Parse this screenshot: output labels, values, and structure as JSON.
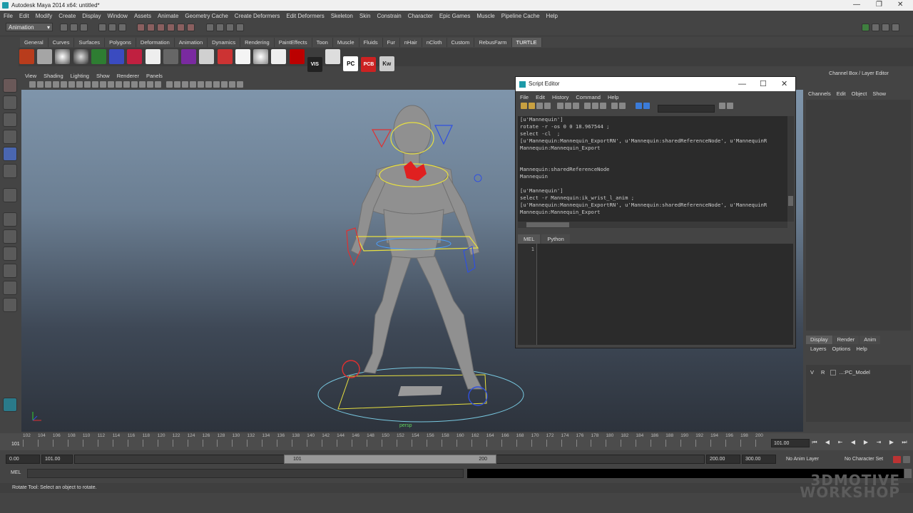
{
  "window": {
    "title": "Autodesk Maya 2014 x64: untitled*"
  },
  "menubar": [
    "File",
    "Edit",
    "Modify",
    "Create",
    "Display",
    "Window",
    "Assets",
    "Animate",
    "Geometry Cache",
    "Create Deformers",
    "Edit Deformers",
    "Skeleton",
    "Skin",
    "Constrain",
    "Character",
    "Epic Games",
    "Muscle",
    "Pipeline Cache",
    "Help"
  ],
  "status": {
    "mode": "Animation"
  },
  "shelf_tabs": [
    "General",
    "Curves",
    "Surfaces",
    "Polygons",
    "Deformation",
    "Animation",
    "Dynamics",
    "Rendering",
    "PaintEffects",
    "Toon",
    "Muscle",
    "Fluids",
    "Fur",
    "nHair",
    "nCloth",
    "Custom",
    "RebusFarm",
    "TURTLE"
  ],
  "shelf_active": "TURTLE",
  "shelf_labels": {
    "vis": "VIS",
    "pc": "PC",
    "pcb": "PCB",
    "kw": "Kw"
  },
  "viewport": {
    "menu": [
      "View",
      "Shading",
      "Lighting",
      "Show",
      "Renderer",
      "Panels"
    ],
    "camera": "persp"
  },
  "script_editor": {
    "title": "Script Editor",
    "menu": [
      "File",
      "Edit",
      "History",
      "Command",
      "Help"
    ],
    "history_lines": [
      "[u'Mannequin']",
      "rotate -r -os 0 0 18.967544 ;",
      "select -cl  ;",
      "[u'Mannequin:Mannequin_ExportRN', u'Mannequin:sharedReferenceNode', u'MannequinR",
      "Mannequin:Mannequin_Export",
      "",
      "",
      "Mannequin:sharedReferenceNode",
      "Mannequin",
      "",
      "[u'Mannequin']",
      "select -r Mannequin:ik_wrist_l_anim ;",
      "[u'Mannequin:Mannequin_ExportRN', u'Mannequin:sharedReferenceNode', u'MannequinR",
      "Mannequin:Mannequin_Export"
    ],
    "tabs": [
      "MEL",
      "Python"
    ],
    "active_tab": "MEL",
    "line_number": "1"
  },
  "channel_box": {
    "title": "Channel Box / Layer Editor",
    "menu": [
      "Channels",
      "Edit",
      "Object",
      "Show"
    ],
    "layer_tabs": [
      "Display",
      "Render",
      "Anim"
    ],
    "layer_menu": [
      "Layers",
      "Options",
      "Help"
    ],
    "layer": {
      "v": "V",
      "r": "R",
      "name": "...:PC_Model"
    }
  },
  "timeline": {
    "current_frame": "101",
    "ticks": [
      "102",
      "104",
      "106",
      "108",
      "110",
      "112",
      "114",
      "116",
      "118",
      "120",
      "122",
      "124",
      "126",
      "128",
      "130",
      "132",
      "134",
      "136",
      "138",
      "140",
      "142",
      "144",
      "146",
      "148",
      "150",
      "152",
      "154",
      "156",
      "158",
      "160",
      "162",
      "164",
      "166",
      "168",
      "170",
      "172",
      "174",
      "176",
      "178",
      "180",
      "182",
      "184",
      "186",
      "188",
      "190",
      "192",
      "194",
      "196",
      "198",
      "200"
    ],
    "frame_field": "101.00"
  },
  "range": {
    "start": "0.00",
    "min": "101.00",
    "bar_start": "101",
    "bar_end": "200",
    "max": "200.00",
    "end": "300.00",
    "anim_layer": "No Anim Layer",
    "character_set": "No Character Set"
  },
  "command_line": {
    "label": "MEL"
  },
  "help_line": "Rotate Tool: Select an object to rotate.",
  "watermark": {
    "line1": "3DMOTIVE",
    "line2": "WORKSHOP"
  }
}
